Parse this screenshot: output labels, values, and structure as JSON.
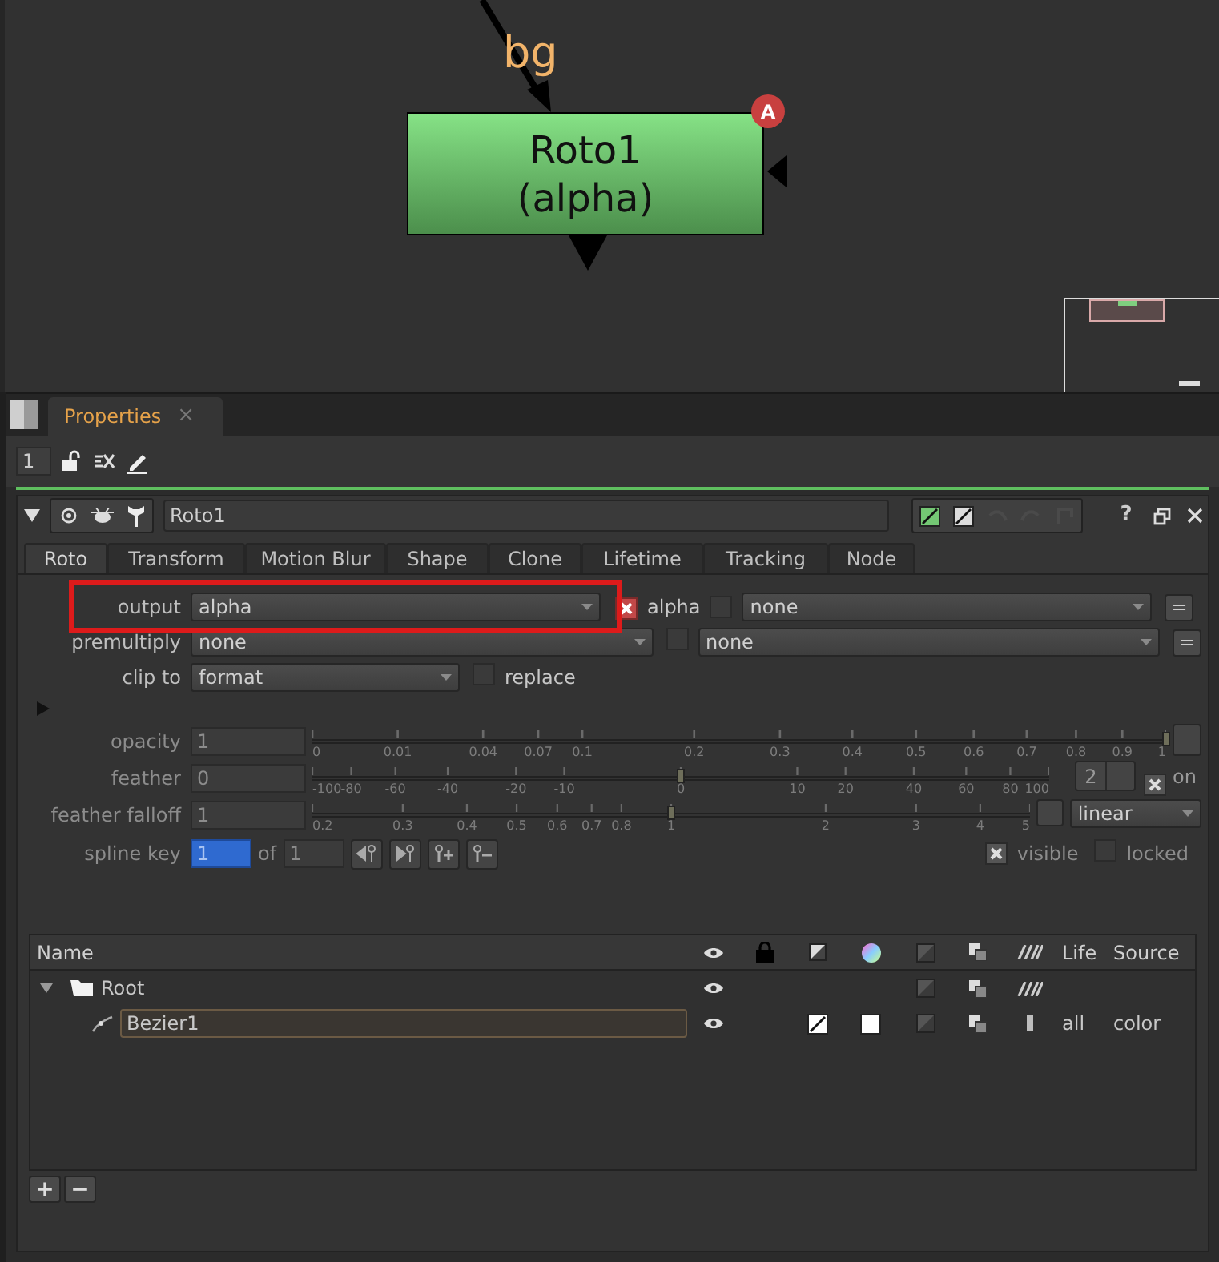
{
  "node_graph": {
    "input_label": "bg",
    "node": {
      "title": "Roto1",
      "subtitle": "(alpha)",
      "badge": "A"
    }
  },
  "panel": {
    "tabs": [
      {
        "label": "Properties",
        "selected": true,
        "close": "×"
      }
    ],
    "max_panels": "1"
  },
  "node": {
    "name": "Roto1",
    "expanded": true,
    "help": "?",
    "tabs": [
      {
        "label": "Roto",
        "selected": true
      },
      {
        "label": "Transform",
        "selected": false
      },
      {
        "label": "Motion Blur",
        "selected": false
      },
      {
        "label": "Shape",
        "selected": false
      },
      {
        "label": "Clone",
        "selected": false
      },
      {
        "label": "Lifetime",
        "selected": false
      },
      {
        "label": "Tracking",
        "selected": false
      },
      {
        "label": "Node",
        "selected": false
      }
    ]
  },
  "roto": {
    "output": {
      "label": "output",
      "value": "alpha",
      "highlighted": true,
      "channel_checked": true,
      "channel": "alpha",
      "extra_checked": false,
      "extra_value": "none",
      "link": "="
    },
    "premultiply": {
      "label": "premultiply",
      "value": "none",
      "checked": false,
      "extra_value": "none",
      "link": "="
    },
    "clip_to": {
      "label": "clip to",
      "value": "format",
      "replace_checked": false,
      "replace_label": "replace"
    },
    "advanced_expanded": false,
    "sliders": [
      {
        "kind": "opacity",
        "label": "opacity",
        "value": "1",
        "level": 1,
        "ticks": [
          "0",
          "0.01",
          "0.04",
          "0.07",
          "0.1",
          "0.2",
          "0.3",
          "0.4",
          "0.5",
          "0.6",
          "0.7",
          "0.8",
          "0.9",
          "1"
        ]
      },
      {
        "kind": "feather",
        "label": "feather",
        "value": "0",
        "level": 0.5,
        "ticks": [
          "-100",
          "-80",
          "-60",
          "-40",
          "-20",
          "-10",
          "0",
          "10",
          "20",
          "40",
          "60",
          "80",
          "100"
        ],
        "extra_value": "2",
        "on_checked": true,
        "on_label": "on"
      },
      {
        "kind": "falloff",
        "label": "feather falloff",
        "value": "1",
        "level": 0.5,
        "ticks": [
          "0.2",
          "0.3",
          "0.4",
          "0.5",
          "0.6",
          "0.7",
          "0.8",
          "1",
          "2",
          "3",
          "4",
          "5"
        ],
        "extra_value": "linear"
      }
    ],
    "spline_key": {
      "label": "spline key",
      "value": "1",
      "of": "of",
      "total": "1"
    },
    "visible": {
      "label": "visible",
      "checked": true
    },
    "locked": {
      "label": "locked",
      "checked": false
    }
  },
  "shapes": {
    "headers": {
      "name": "Name",
      "life": "Life",
      "source": "Source"
    },
    "rows": [
      {
        "kind": "folder",
        "name": "Root",
        "expanded": true,
        "children": [
          {
            "kind": "bezier",
            "name": "Bezier1",
            "selected": true,
            "life": "all",
            "source": "color"
          }
        ]
      }
    ]
  },
  "footer": {
    "add": "+",
    "remove": "−"
  }
}
